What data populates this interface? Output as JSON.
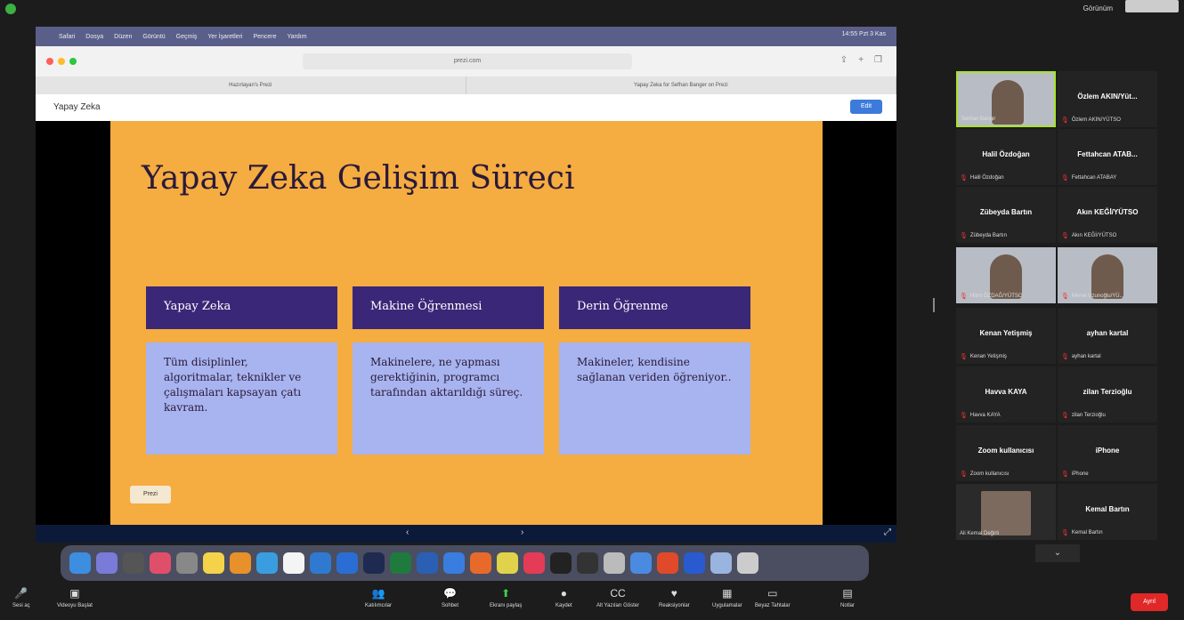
{
  "top": {
    "view_label": "Görünüm",
    "self_label": ""
  },
  "mac_menu": {
    "app": "Safari",
    "items": [
      "Dosya",
      "Düzen",
      "Görüntü",
      "Geçmiş",
      "Yer İşaretleri",
      "Pencere",
      "Yardım"
    ],
    "clock": "14:55 Pzt 3 Kas"
  },
  "browser": {
    "url": "prezi.com",
    "tabs": [
      "Hazırlayan's Prezi",
      "Yapay Zeka for Sefhan Banger on Prezi"
    ]
  },
  "prezi": {
    "page_title": "Yapay Zeka",
    "edit_label": "Edit",
    "badge": "Prezi"
  },
  "slide": {
    "title": "Yapay Zeka Gelişim Süreci",
    "columns": [
      {
        "head": "Yapay Zeka",
        "body": "Tüm disiplinler, algoritmalar, teknikler ve çalışmaları kapsayan çatı kavram."
      },
      {
        "head": "Makine Öğrenmesi",
        "body": "Makinelere, ne yapması gerektiğinin, programcı tarafından aktarıldığı süreç."
      },
      {
        "head": "Derin Öğrenme",
        "body": "Makineler, kendisine sağlanan veriden öğreniyor.."
      }
    ]
  },
  "nav": {
    "prev": "‹",
    "next": "›",
    "fullscreen": "⤢"
  },
  "participants": [
    {
      "name": "Serhan Bangir",
      "label": "Serhan Bangir",
      "video": true,
      "active": true
    },
    {
      "name": "Özlem AKIN/Yüt...",
      "label": "Özlem AKIN/YÜTSO",
      "video": false
    },
    {
      "name": "Halil Özdoğan",
      "label": "Halil Özdoğan",
      "video": false
    },
    {
      "name": "Fettahcan ATAB...",
      "label": "Fettahcan ATABAY",
      "video": false
    },
    {
      "name": "Zübeyda Bartın",
      "label": "Zübeyda Bartın",
      "video": false
    },
    {
      "name": "Akın KEĞİ/YÜTSO",
      "label": "Akın KEĞİ/YÜTSO",
      "video": false
    },
    {
      "name": "",
      "label": "Hilmi ÖZDAĞ/YÜTSO",
      "video": true
    },
    {
      "name": "",
      "label": "Merve Uzunoğlu/YÜ...",
      "video": true
    },
    {
      "name": "Kenan Yetişmiş",
      "label": "Kenan Yetişmiş",
      "video": false
    },
    {
      "name": "ayhan kartal",
      "label": "ayhan kartal",
      "video": false
    },
    {
      "name": "Havva KAYA",
      "label": "Havva KAYA",
      "video": false
    },
    {
      "name": "zilan Terzioğlu",
      "label": "zilan Terzioğlu",
      "video": false
    },
    {
      "name": "Zoom kullanıcısı",
      "label": "Zoom kullanıcısı",
      "video": false
    },
    {
      "name": "iPhone",
      "label": "iPhone",
      "video": false
    },
    {
      "name": "",
      "label": "Ali Kemal Değirli",
      "video": true
    },
    {
      "name": "Kemal Bartın",
      "label": "Kemal Bartın",
      "video": false
    }
  ],
  "toolbar": {
    "items": [
      {
        "label": "Sesi aç",
        "icon": "🎤"
      },
      {
        "label": "Videoyu Başlat",
        "icon": "▣"
      },
      {
        "label": "Katılımcılar",
        "icon": "👥"
      },
      {
        "label": "Sohbet",
        "icon": "💬"
      },
      {
        "label": "Ekranı paylaş",
        "icon": "⬆"
      },
      {
        "label": "Kaydet",
        "icon": "●"
      },
      {
        "label": "Alt Yazıları Göster",
        "icon": "CC"
      },
      {
        "label": "Reaksiyonlar",
        "icon": "♥"
      },
      {
        "label": "Uygulamalar",
        "icon": "▦"
      },
      {
        "label": "Beyaz Tahtalar",
        "icon": "▭"
      },
      {
        "label": "Notlar",
        "icon": "▤"
      }
    ],
    "end_label": "Ayrıl"
  },
  "colors": {
    "slide_bg": "#f5ac40",
    "head_bg": "#3b2778",
    "body_bg": "#a8b4ef",
    "zoom_green": "#3cd24c",
    "end_red": "#e02828"
  }
}
